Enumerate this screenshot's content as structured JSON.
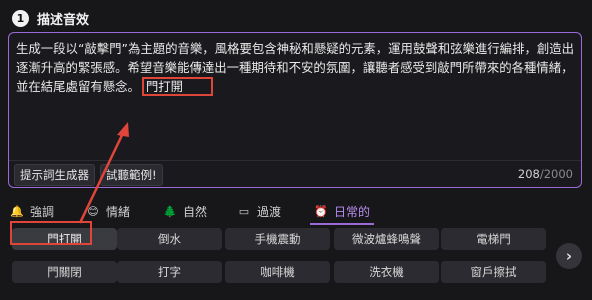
{
  "header": {
    "step_number": "1",
    "title": "描述音效"
  },
  "editor": {
    "prompt_main": "生成一段以“敲擊門”為主題的音樂，風格要包含神秘和懸疑的元素，運用鼓聲和弦樂進行編排，創造出逐漸升高的緊張感。希望音樂能傳達出一種期待和不安的氛圍，讓聽者感受到敲門所帶來的各種情緒，並在結尾處留有懸念。",
    "prompt_tag": "門打開",
    "prompt_generator_label": "提示詞生成器",
    "try_example_label": "試聽範例!",
    "char_count": "208",
    "char_max": "/2000"
  },
  "tabs": [
    {
      "label": "強調",
      "icon": "bell-icon",
      "glyph": "🔔"
    },
    {
      "label": "情緒",
      "icon": "smile-icon",
      "glyph": "😊"
    },
    {
      "label": "自然",
      "icon": "tree-icon",
      "glyph": "🌲"
    },
    {
      "label": "過渡",
      "icon": "transition-icon",
      "glyph": "▭"
    },
    {
      "label": "日常的",
      "icon": "alarm-clock-icon",
      "glyph": "⏰",
      "active": true
    }
  ],
  "chips_row1": [
    "門打開",
    "倒水",
    "手機震動",
    "微波爐蜂鳴聲",
    "電梯門"
  ],
  "chips_row2": [
    "門關閉",
    "打字",
    "咖啡機",
    "洗衣機",
    "窗戶擦拭"
  ],
  "colors": {
    "accent": "#9b6ad6",
    "annotation": "#e0453a",
    "background": "#17171a"
  }
}
